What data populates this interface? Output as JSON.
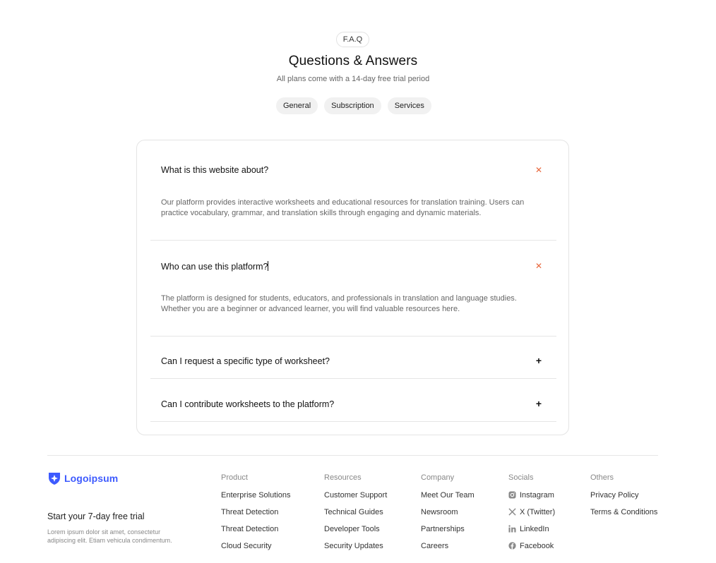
{
  "header": {
    "tag": "F.A.Q",
    "title": "Questions & Answers",
    "subtitle": "All plans come with a 14-day free trial period"
  },
  "tabs": [
    "General",
    "Subscription",
    "Services"
  ],
  "faq": [
    {
      "question": "What is this website about?",
      "answer": "Our platform provides interactive worksheets and educational resources for translation training. Users can practice vocabulary, grammar, and translation skills through engaging and dynamic materials.",
      "icon": "close-icon",
      "expanded": true
    },
    {
      "question": "Who can use this platform?",
      "answer": "The platform is designed for students, educators, and professionals in translation and language studies. Whether you are a beginner or advanced learner, you will find valuable resources here.",
      "icon": "close-icon",
      "expanded": true
    },
    {
      "question": "Can I request a specific type of worksheet?",
      "icon": "plus-icon",
      "expanded": false
    },
    {
      "question": "Can I contribute worksheets to the platform?",
      "icon": "plus-icon",
      "expanded": false
    }
  ],
  "footer": {
    "logo_text": "Logoipsum",
    "trial_title": "Start your 7-day free trial",
    "trial_desc": "Lorem ipsum dolor sit amet, consectetur adipiscing elit. Etiam vehicula condimentum.",
    "columns": [
      {
        "title": "Product",
        "items": [
          "Enterprise Solutions",
          "Threat Detection",
          "Threat Detection",
          "Cloud Security"
        ]
      },
      {
        "title": "Resources",
        "items": [
          "Customer Support",
          "Technical Guides",
          "Developer Tools",
          "Security Updates"
        ]
      },
      {
        "title": "Company",
        "items": [
          "Meet Our Team",
          "Newsroom",
          "Partnerships",
          "Careers"
        ]
      },
      {
        "title": "Socials",
        "items": [
          "Instagram",
          "X (Twitter)",
          "LinkedIn",
          "Facebook"
        ]
      },
      {
        "title": "Others",
        "items": [
          "Privacy Policy",
          "Terms & Conditions"
        ]
      }
    ]
  },
  "colors": {
    "accent": "#e8663b",
    "brand": "#3d5afe"
  }
}
